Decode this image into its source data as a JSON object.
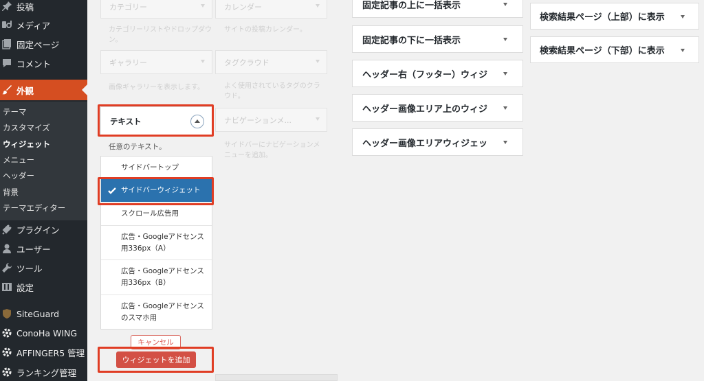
{
  "sidebar": {
    "items": [
      {
        "label": "投稿",
        "icon": "pin-icon"
      },
      {
        "label": "メディア",
        "icon": "media-icon"
      },
      {
        "label": "固定ページ",
        "icon": "page-icon"
      },
      {
        "label": "コメント",
        "icon": "comment-icon"
      },
      {
        "label": "外観",
        "icon": "brush-icon"
      },
      {
        "label": "プラグイン",
        "icon": "plugin-icon"
      },
      {
        "label": "ユーザー",
        "icon": "user-icon"
      },
      {
        "label": "ツール",
        "icon": "wrench-icon"
      },
      {
        "label": "設定",
        "icon": "settings-icon"
      },
      {
        "label": "SiteGuard",
        "icon": "siteguard-icon"
      },
      {
        "label": "ConoHa WING",
        "icon": "gear-icon"
      },
      {
        "label": "AFFINGER5 管理",
        "icon": "gear-icon"
      },
      {
        "label": "ランキング管理",
        "icon": "gear-icon"
      }
    ],
    "submenu": [
      "テーマ",
      "カスタマイズ",
      "ウィジェット",
      "メニュー",
      "ヘッダー",
      "背景",
      "テーマエディター"
    ]
  },
  "widgets": {
    "category": {
      "title": "カテゴリー",
      "desc": "カテゴリーリストやドロップダウン。"
    },
    "calendar": {
      "title": "カレンダー",
      "desc": "サイトの投稿カレンダー。"
    },
    "gallery": {
      "title": "ギャラリー",
      "desc": "画像ギャラリーを表示します。"
    },
    "tagcloud": {
      "title": "タグクラウド",
      "desc": "よく使用されているタグのクラウド。"
    },
    "text": {
      "title": "テキスト",
      "desc": "任意のテキスト。"
    },
    "navigation": {
      "title": "ナビゲーションメ...",
      "desc": "サイドバーにナビゲーションメニューを追加。"
    }
  },
  "choose": {
    "options": [
      "サイドバートップ",
      "サイドバーウィジェット",
      "スクロール広告用",
      "広告・Googleアドセンス用336px（A）",
      "広告・Googleアドセンス用336px（B）",
      "広告・Googleアドセンスのスマホ用"
    ],
    "selected_index": 1,
    "cancel_label": "キャンセル",
    "add_label": "ウィジェットを追加"
  },
  "areas_col1": [
    "固定記事の上に一括表示",
    "固定記事の下に一括表示",
    "ヘッダー右（フッター）ウィジ",
    "ヘッダー画像エリア上のウィジ",
    "ヘッダー画像エリアウィジェッ"
  ],
  "areas_col2": [
    "検索結果ページ（上部）に表示",
    "検索結果ページ（下部）に表示"
  ],
  "colors": {
    "sidebar_bg": "#23282d",
    "active_menu": "#d54e21",
    "selected_option": "#2b72ae",
    "highlight_frame": "#e03d24",
    "add_button": "#d35045"
  }
}
